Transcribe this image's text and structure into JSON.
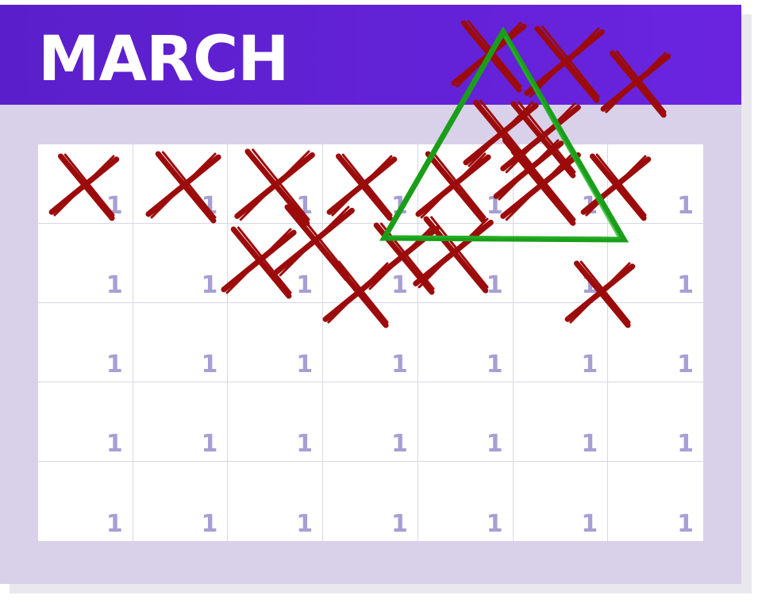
{
  "calendar": {
    "month": "MARCH",
    "weeks": [
      [
        "1",
        "1",
        "1",
        "1",
        "1",
        "1",
        "1"
      ],
      [
        "1",
        "1",
        "1",
        "1",
        "1",
        "1",
        "1"
      ],
      [
        "1",
        "1",
        "1",
        "1",
        "1",
        "1",
        "1"
      ],
      [
        "1",
        "1",
        "1",
        "1",
        "1",
        "1",
        "1"
      ],
      [
        "1",
        "1",
        "1",
        "1",
        "1",
        "1",
        "1"
      ]
    ]
  },
  "colors": {
    "header": "#5a1fca",
    "card": "#d9d1e9",
    "day_number": "#a79fd4",
    "cross_mark": "#9c0b0b",
    "triangle": "#1a9e1a"
  },
  "annotations": {
    "cross_marks": "red-x-marks",
    "shape": "green-triangle"
  }
}
